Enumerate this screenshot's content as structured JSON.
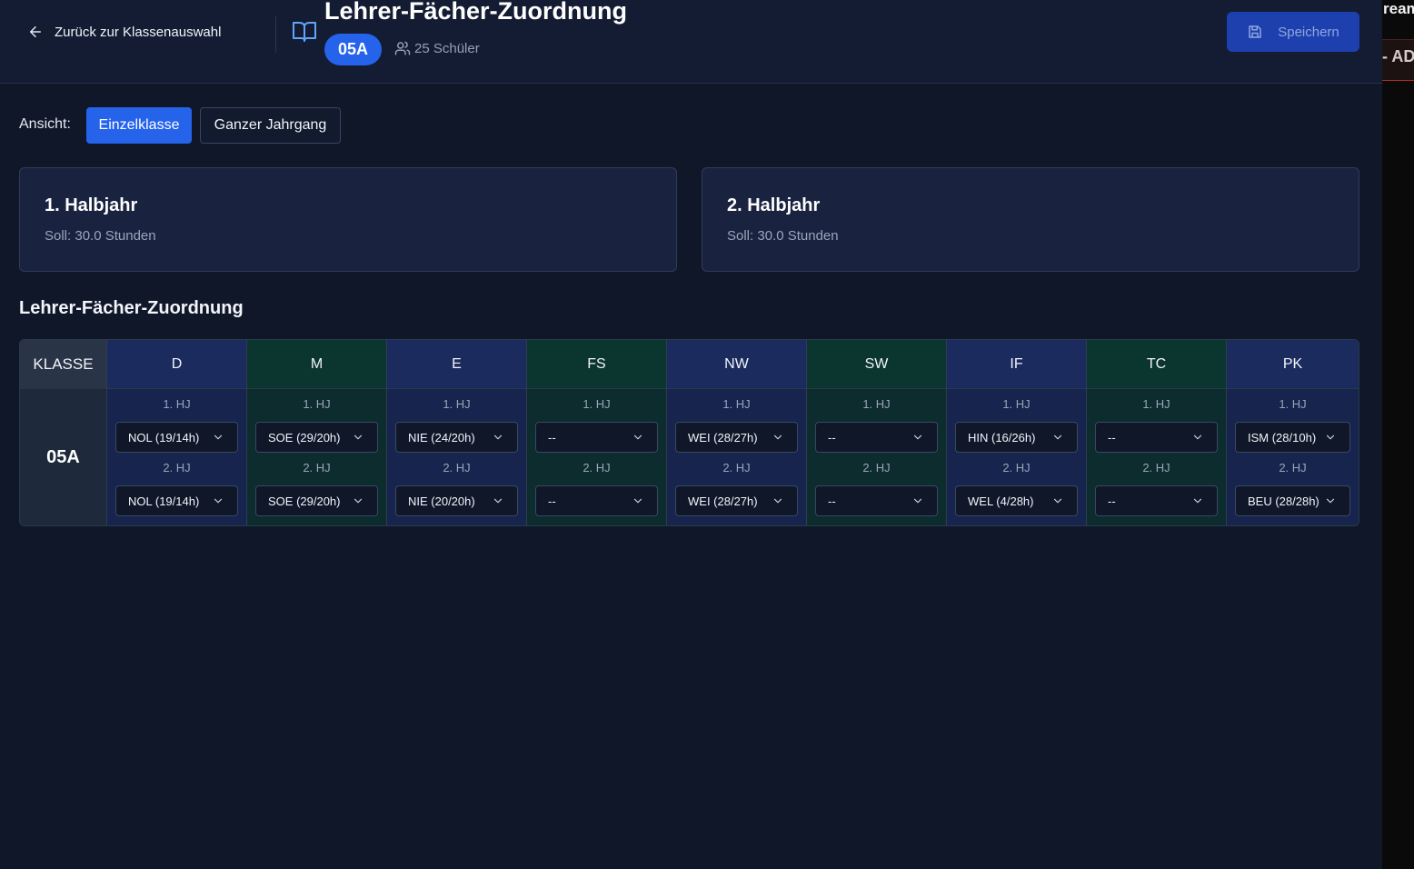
{
  "header": {
    "back_label": "Zurück zur Klassenauswahl",
    "title": "Lehrer-Fächer-Zuordnung",
    "class_badge": "05A",
    "students": "25 Schüler",
    "save_label": "Speichern"
  },
  "side_panel": {
    "text_top": "ream",
    "text_badge": "- AD"
  },
  "view": {
    "label": "Ansicht:",
    "options": [
      "Einzelklasse",
      "Ganzer Jahrgang"
    ],
    "active": "Einzelklasse"
  },
  "semesters": [
    {
      "title": "1. Halbjahr",
      "soll": "Soll: 30.0 Stunden"
    },
    {
      "title": "2. Halbjahr",
      "soll": "Soll: 30.0 Stunden"
    }
  ],
  "section_title": "Lehrer-Fächer-Zuordnung",
  "table": {
    "klasse_header": "KLASSE",
    "row_class": "05A",
    "hj1_label": "1. HJ",
    "hj2_label": "2. HJ",
    "subjects": [
      {
        "code": "D",
        "color": "blue",
        "hj1": "NOL (19/14h)",
        "hj2": "NOL (19/14h)"
      },
      {
        "code": "M",
        "color": "green",
        "hj1": "SOE (29/20h)",
        "hj2": "SOE (29/20h)"
      },
      {
        "code": "E",
        "color": "blue",
        "hj1": "NIE (24/20h)",
        "hj2": "NIE (20/20h)"
      },
      {
        "code": "FS",
        "color": "green",
        "hj1": "--",
        "hj2": "--"
      },
      {
        "code": "NW",
        "color": "blue",
        "hj1": "WEI (28/27h)",
        "hj2": "WEI (28/27h)"
      },
      {
        "code": "SW",
        "color": "green",
        "hj1": "--",
        "hj2": "--"
      },
      {
        "code": "IF",
        "color": "blue",
        "hj1": "HIN (16/26h)",
        "hj2": "WEL (4/28h)"
      },
      {
        "code": "TC",
        "color": "green",
        "hj1": "--",
        "hj2": "--"
      },
      {
        "code": "PK",
        "color": "blue",
        "hj1": "ISM (28/10h)",
        "hj2": "BEU (28/28h)"
      }
    ]
  },
  "colors": {
    "accent": "#2563eb",
    "background": "#0f1729",
    "header": "#131c33",
    "subject_blue": "#17244d",
    "subject_green": "#0d2c2e"
  }
}
